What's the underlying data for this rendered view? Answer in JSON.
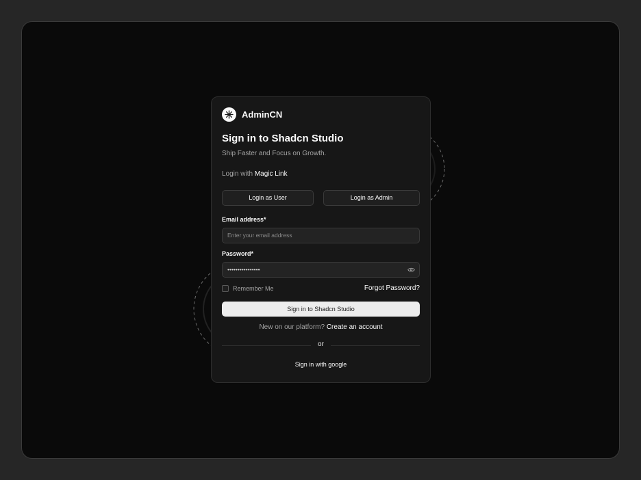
{
  "brand": {
    "name": "AdminCN"
  },
  "header": {
    "title": "Sign in to Shadcn Studio",
    "subtitle": "Ship Faster and Focus on Growth."
  },
  "magic_login": {
    "prefix": "Login with ",
    "link": "Magic Link"
  },
  "quick_login": {
    "user_label": "Login as User",
    "admin_label": "Login as Admin"
  },
  "form": {
    "email_label": "Email address*",
    "email_placeholder": "Enter your email address",
    "password_label": "Password*",
    "password_value": "••••••••••••••••",
    "remember_label": "Remember Me",
    "forgot_label": "Forgot Password?",
    "submit_label": "Sign in to Shadcn Studio"
  },
  "signup": {
    "prefix": "New on our platform? ",
    "link": "Create an account"
  },
  "divider": {
    "text": "or"
  },
  "social": {
    "google_label": "Sign in with google"
  },
  "icons": {
    "logo": "asterisk-logo-icon",
    "eye": "eye-icon"
  },
  "colors": {
    "background": "#0a0a0a",
    "card": "#171717",
    "primary_button": "#ededed"
  }
}
